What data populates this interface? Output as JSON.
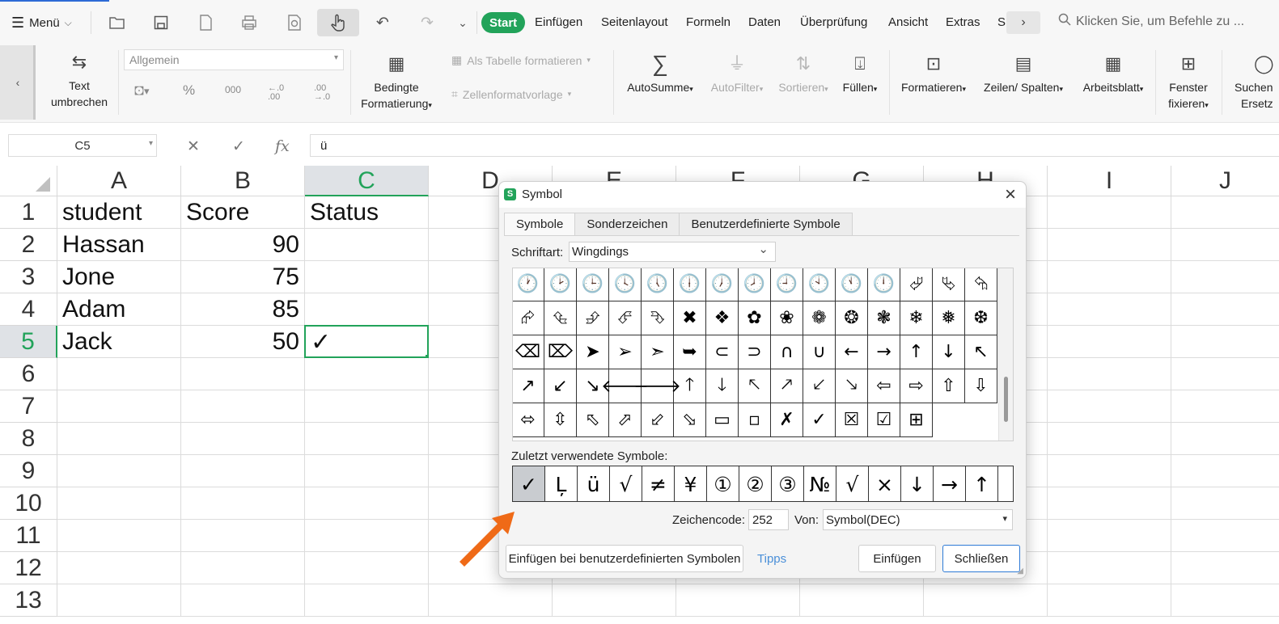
{
  "menubar": {
    "menu_label": "Menü",
    "tabs": [
      "Start",
      "Einfügen",
      "Seitenlayout",
      "Formeln",
      "Daten",
      "Überprüfung",
      "Ansicht",
      "Extras",
      "S"
    ],
    "more_icon": "chevron-right-icon",
    "search_placeholder": "Klicken Sie, um Befehle zu ..."
  },
  "ribbon": {
    "wrap_text": [
      "Text",
      "umbrechen"
    ],
    "number_format": "Allgemein",
    "percent": "%",
    "thousands": "000",
    "dec_inc": "←.0\n.00",
    "dec_dec": ".00\n→.0",
    "conditional": [
      "Bedingte",
      "Formatierung"
    ],
    "as_table": "Als Tabelle formatieren",
    "cell_style": "Zellenformatvorlage",
    "autosum": "AutoSumme",
    "autofilter": "AutoFilter",
    "sort": "Sortieren",
    "fill": "Füllen",
    "format": "Formatieren",
    "rows_cols": "Zeilen/ Spalten",
    "sheet": "Arbeitsblatt",
    "freeze": [
      "Fenster",
      "fixieren"
    ],
    "find": [
      "Suchen",
      "Ersetz"
    ]
  },
  "formula_bar": {
    "name_box": "C5",
    "content": "ü"
  },
  "sheet": {
    "columns": [
      "A",
      "B",
      "C",
      "D",
      "E",
      "F",
      "G",
      "H",
      "I",
      "J"
    ],
    "rows": [
      "1",
      "2",
      "3",
      "4",
      "5",
      "6",
      "7",
      "8",
      "9",
      "10",
      "11",
      "12",
      "13"
    ],
    "cells": {
      "A1": "student",
      "B1": "Score",
      "C1": "Status",
      "A2": "Hassan",
      "B2": "90",
      "A3": "Jone",
      "B3": "75",
      "A4": "Adam",
      "B4": "85",
      "A5": "Jack",
      "B5": "50",
      "C5": "✓"
    }
  },
  "dialog": {
    "title": "Symbol",
    "tabs": [
      "Symbole",
      "Sonderzeichen",
      "Benutzerdefinierte Symbole"
    ],
    "font_label": "Schriftart:",
    "font_value": "Wingdings",
    "symbols": [
      [
        "🕐",
        "🕑",
        "🕒",
        "🕓",
        "🕔",
        "🕕",
        "🕖",
        "🕗",
        "🕘",
        "🕙",
        "🕚",
        "🕛",
        "⮰",
        "⮱",
        "⮲"
      ],
      [
        "⮳",
        "⮴",
        "⮵",
        "⮶",
        "⮷",
        "✖",
        "❖",
        "✿",
        "❀",
        "❁",
        "❂",
        "❃",
        "❄",
        "❅",
        "❆"
      ],
      [
        "⌫",
        "⌦",
        "➤",
        "➢",
        "➣",
        "➥",
        "⊂",
        "⊃",
        "∩",
        "∪",
        "←",
        "→",
        "↑",
        "↓",
        "↖"
      ],
      [
        "↗",
        "↙",
        "↘",
        "🡐",
        "🡒",
        "🡑",
        "🡓",
        "🡔",
        "🡕",
        "🡗",
        "🡖",
        "⇦",
        "⇨",
        "⇧",
        "⇩"
      ],
      [
        "⬄",
        "⇳",
        "⬁",
        "⬀",
        "⬃",
        "⬂",
        "▭",
        "▫",
        "✗",
        "✓",
        "☒",
        "☑",
        "⊞"
      ]
    ],
    "recent_label": "Zuletzt verwendete Symbole:",
    "recent": [
      "✓",
      "Ļ",
      "ü",
      "√",
      "≠",
      "¥",
      "①",
      "②",
      "③",
      "№",
      "√",
      "×",
      "↓",
      "→",
      "↑"
    ],
    "code_label": "Zeichencode:",
    "code_value": "252",
    "from_label": "Von:",
    "from_value": "Symbol(DEC)",
    "custom_button": "Einfügen bei benutzerdefinierten Symbolen",
    "tips": "Tipps",
    "insert_button": "Einfügen",
    "close_button": "Schließen"
  }
}
